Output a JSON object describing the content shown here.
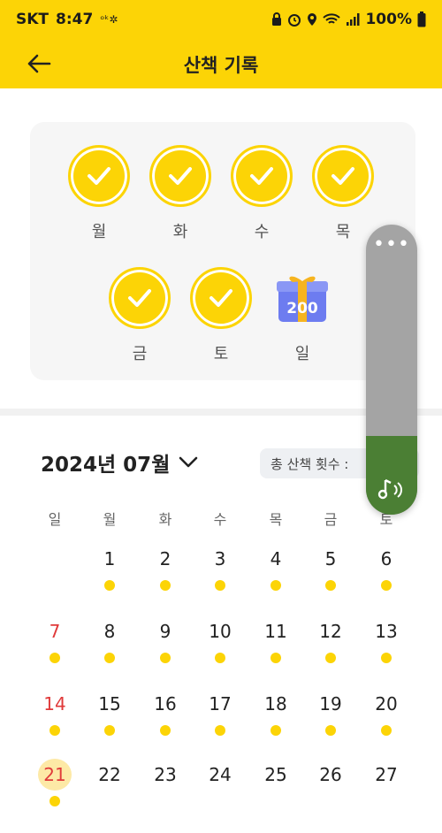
{
  "status_bar": {
    "carrier": "SKT",
    "time": "8:47",
    "extra": "ᵒᵏ✲",
    "icons": [
      "lock-icon",
      "alarm-icon",
      "location-icon",
      "wifi-icon",
      "signal-icon"
    ],
    "battery": "100%"
  },
  "header": {
    "title": "산책 기록",
    "back_icon": "arrow-left-icon"
  },
  "week": {
    "days": [
      {
        "label": "월",
        "done": true
      },
      {
        "label": "화",
        "done": true
      },
      {
        "label": "수",
        "done": true
      },
      {
        "label": "목",
        "done": true
      },
      {
        "label": "금",
        "done": true
      },
      {
        "label": "토",
        "done": true
      },
      {
        "label": "일",
        "done": false,
        "reward": "200"
      }
    ]
  },
  "calendar": {
    "month_title": "2024년 07월",
    "total_label": "총 산책 횟수 :",
    "weekdays": [
      "일",
      "월",
      "화",
      "수",
      "목",
      "금",
      "토"
    ],
    "rows": [
      [
        "",
        "1",
        "2",
        "3",
        "4",
        "5",
        "6"
      ],
      [
        "7",
        "8",
        "9",
        "10",
        "11",
        "12",
        "13"
      ],
      [
        "14",
        "15",
        "16",
        "17",
        "18",
        "19",
        "20"
      ],
      [
        "21",
        "22",
        "23",
        "24",
        "25",
        "26",
        "27"
      ]
    ],
    "walked_days": [
      "1",
      "2",
      "3",
      "4",
      "5",
      "6",
      "7",
      "8",
      "9",
      "10",
      "11",
      "12",
      "13",
      "14",
      "15",
      "16",
      "17",
      "18",
      "19",
      "20",
      "21"
    ],
    "today": "21"
  },
  "floating_player": {
    "menu_icon": "more-dots-icon",
    "level": 0.27,
    "action_icon": "music-note-icon"
  },
  "colors": {
    "accent": "#fcd406",
    "sunday": "#e03a3a",
    "player_green": "#4b7f34",
    "today_bg": "#fde9a6"
  }
}
